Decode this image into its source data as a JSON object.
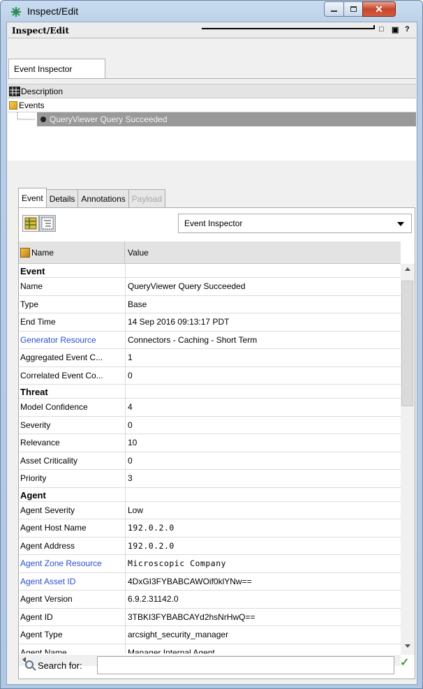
{
  "window": {
    "title": "Inspect/Edit"
  },
  "panel": {
    "title": "Inspect/Edit",
    "help_glyph": "?"
  },
  "top_tab": {
    "label": "Event Inspector"
  },
  "tree": {
    "header": "Description",
    "root": "Events",
    "selected_item": "QueryViewer Query Succeeded"
  },
  "sub_tabs": [
    {
      "label": "Event",
      "state": "active"
    },
    {
      "label": "Details",
      "state": "normal"
    },
    {
      "label": "Annotations",
      "state": "normal"
    },
    {
      "label": "Payload",
      "state": "disabled"
    }
  ],
  "inspector_select": {
    "value": "Event Inspector"
  },
  "grid": {
    "col_name": "Name",
    "col_value": "Value",
    "rows": [
      {
        "name": "Event",
        "value": "",
        "section": true
      },
      {
        "name": "Name",
        "value": "QueryViewer Query Succeeded"
      },
      {
        "name": "Type",
        "value": "Base"
      },
      {
        "name": "End Time",
        "value": "14 Sep 2016 09:13:17 PDT"
      },
      {
        "name": "Generator Resource",
        "value": "Connectors - Caching - Short Term",
        "link": true
      },
      {
        "name": "Aggregated Event C...",
        "value": "1"
      },
      {
        "name": "Correlated Event Co...",
        "value": "0"
      },
      {
        "name": "Threat",
        "value": "",
        "section": true
      },
      {
        "name": "Model Confidence",
        "value": "4"
      },
      {
        "name": "Severity",
        "value": "0"
      },
      {
        "name": "Relevance",
        "value": "10"
      },
      {
        "name": "Asset Criticality",
        "value": "0"
      },
      {
        "name": "Priority",
        "value": "3"
      },
      {
        "name": "Agent",
        "value": "",
        "section": true
      },
      {
        "name": "Agent Severity",
        "value": "Low"
      },
      {
        "name": "Agent Host Name",
        "value": "192.0.2.0",
        "mono": true
      },
      {
        "name": "Agent Address",
        "value": "192.0.2.0",
        "mono": true
      },
      {
        "name": "Agent Zone Resource",
        "value": "Microscopic Company",
        "link": true,
        "mono": true
      },
      {
        "name": "Agent Asset ID",
        "value": "4DxGI3FYBABCAWOif0klYNw==",
        "link": true
      },
      {
        "name": "Agent Version",
        "value": "6.9.2.31142.0"
      },
      {
        "name": "Agent ID",
        "value": "3TBKI3FYBABCAYd2hsNrHwQ=="
      },
      {
        "name": "Agent Type",
        "value": "arcsight_security_manager"
      },
      {
        "name": "Agent Name",
        "value": "Manager Internal Agent"
      }
    ]
  },
  "search": {
    "label": "Search for:",
    "value": ""
  },
  "colors": {
    "link": "#2b4fd3",
    "selection": "#999999",
    "ok": "#3fa132"
  }
}
